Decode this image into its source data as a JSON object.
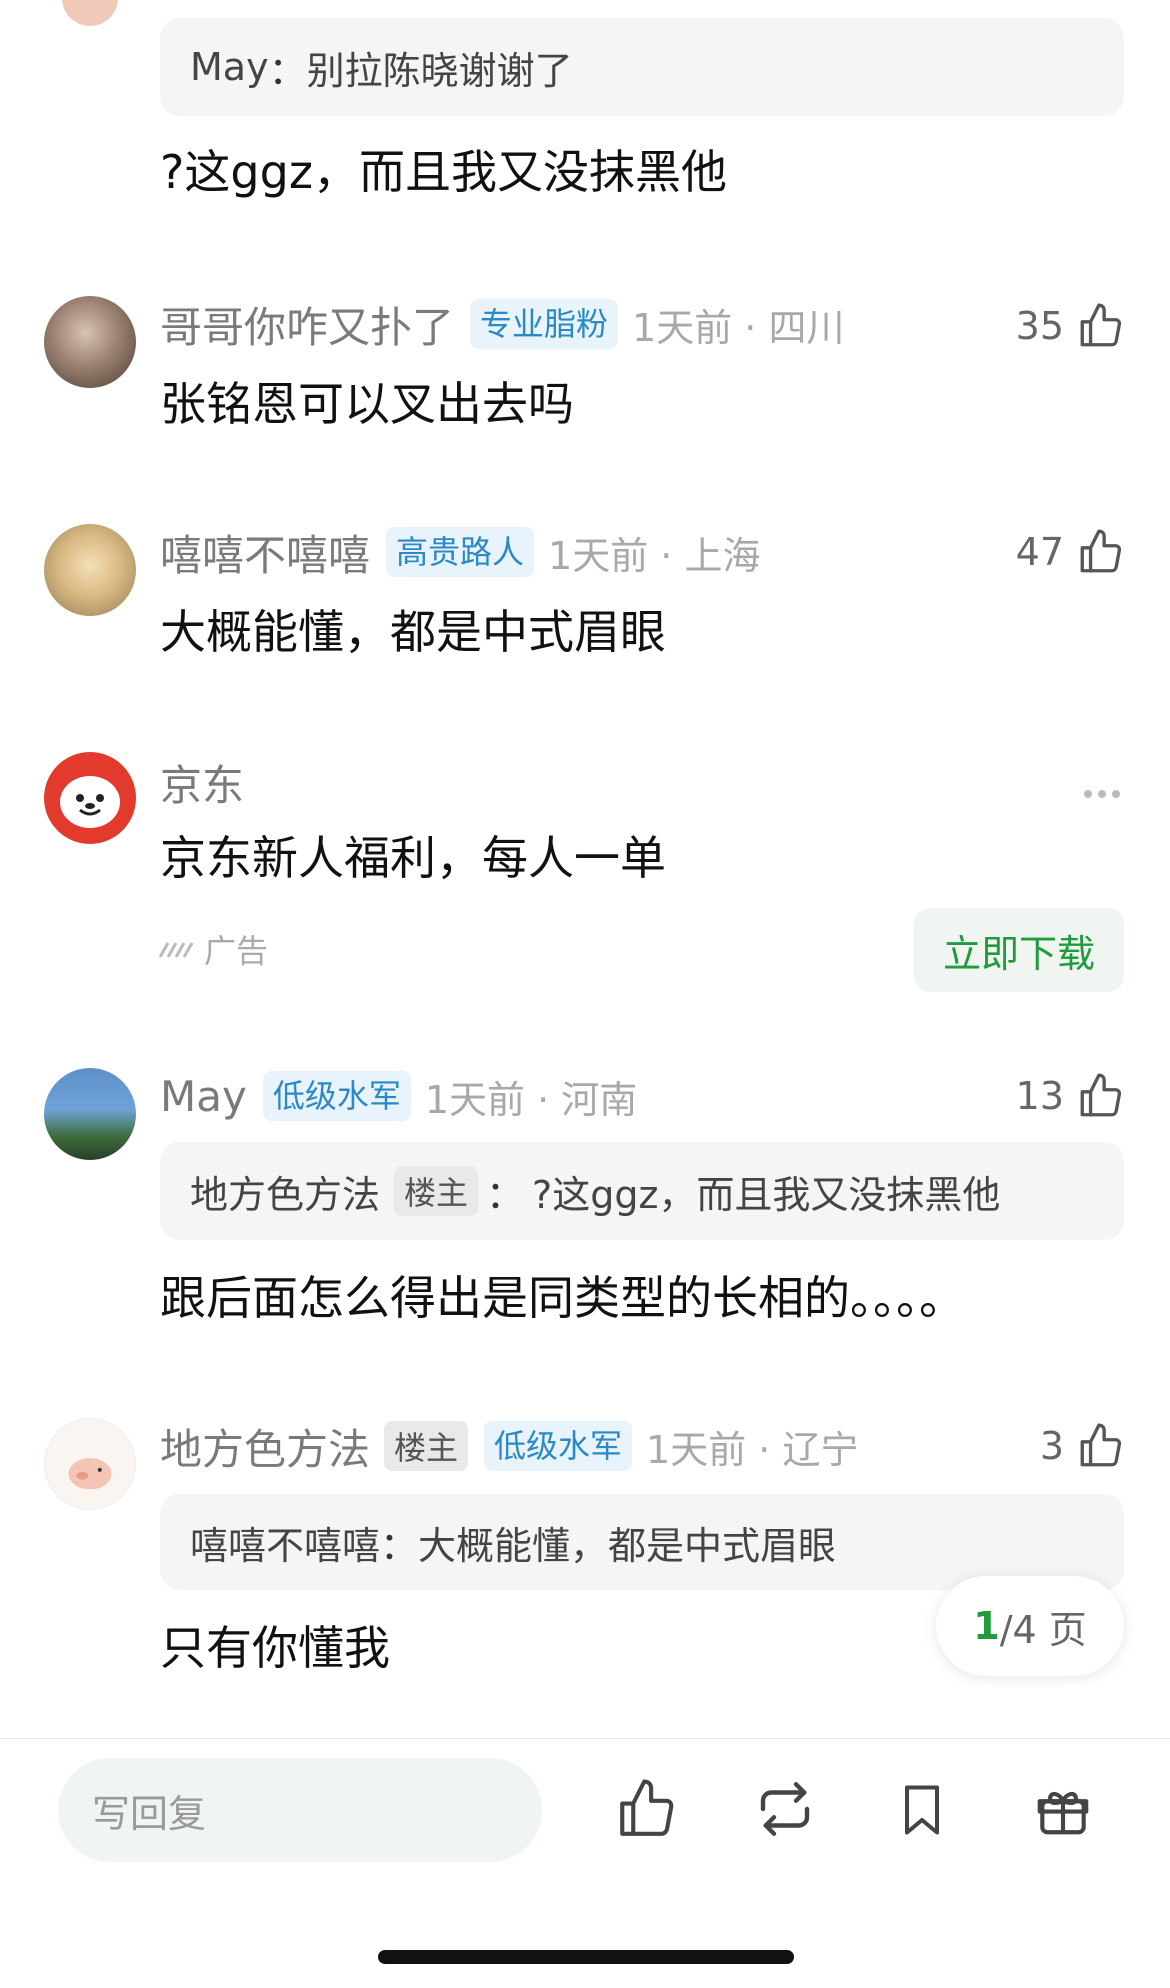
{
  "thread": {
    "top_quote": {
      "name": "May",
      "sep": "：",
      "text": "别拉陈晓谢谢了"
    },
    "top_body": "?这ggz，而且我又没抹黑他"
  },
  "comments": [
    {
      "user": "哥哥你咋又扑了",
      "badge": "专业脂粉",
      "meta": "1天前 · 四川",
      "likes": "35",
      "text": "张铭恩可以叉出去吗"
    },
    {
      "user": "嘻嘻不嘻嘻",
      "badge": "高贵路人",
      "meta": "1天前 · 上海",
      "likes": "47",
      "text": "大概能懂，都是中式眉眼"
    },
    {
      "user": "May",
      "badge": "低级水军",
      "meta": "1天前 · 河南",
      "likes": "13",
      "quote": {
        "name": "地方色方法",
        "op_tag": "楼主",
        "sep": "：",
        "text": "?这ggz，而且我又没抹黑他"
      },
      "text": "跟后面怎么得出是同类型的长相的。。。。"
    },
    {
      "user": "地方色方法",
      "op_tag": "楼主",
      "badge": "低级水军",
      "meta": "1天前 · 辽宁",
      "likes": "3",
      "quote": {
        "name": "嘻嘻不嘻嘻",
        "sep": "：",
        "text": "大概能懂，都是中式眉眼"
      },
      "text": "只有你懂我"
    }
  ],
  "ad": {
    "advertiser": "京东",
    "text": "京东新人福利，每人一单",
    "label": "广告",
    "cta": "立即下载"
  },
  "pager": {
    "current": "1",
    "total": "/4 页"
  },
  "bottom_bar": {
    "reply_placeholder": "写回复"
  },
  "colors": {
    "accent_green": "#1f9c3c",
    "badge_blue": "#2b8ac6"
  },
  "icons": [
    "thumb-up-icon",
    "repost-icon",
    "bookmark-icon",
    "gift-icon",
    "more-icon",
    "ad-logo-icon"
  ]
}
